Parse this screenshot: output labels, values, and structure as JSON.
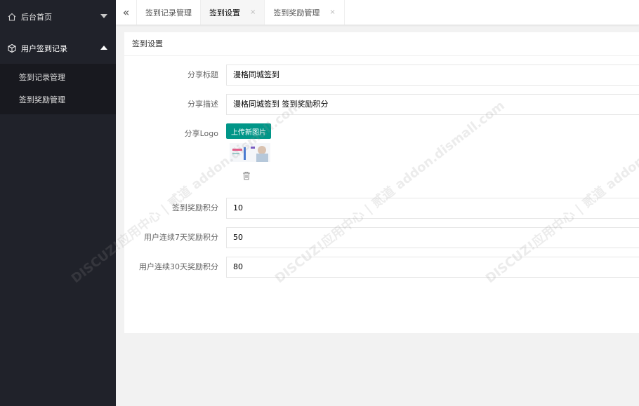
{
  "sidebar": {
    "home_label": "后台首页",
    "group_label": "用户签到记录",
    "items": [
      {
        "label": "签到记录管理"
      },
      {
        "label": "签到奖励管理"
      }
    ]
  },
  "tabs": [
    {
      "label": "签到记录管理"
    },
    {
      "label": "签到设置",
      "close": "×"
    },
    {
      "label": "签到奖励管理",
      "close": "×"
    }
  ],
  "panel": {
    "title": "签到设置",
    "fields": {
      "share_title": {
        "label": "分享标题",
        "value": "漫格同城签到"
      },
      "share_desc": {
        "label": "分享描述",
        "value": "漫格同城签到 签到奖励积分"
      },
      "share_logo": {
        "label": "分享Logo",
        "upload_label": "上传新图片"
      },
      "reward_points": {
        "label": "签到奖励积分",
        "value": "10"
      },
      "streak7_points": {
        "label": "用户连续7天奖励积分",
        "value": "50"
      },
      "streak30_points": {
        "label": "用户连续30天奖励积分",
        "value": "80"
      }
    }
  },
  "watermark": "DISCUZ!应用中心 | 贰道 addon.dismall.com",
  "colors": {
    "sidebar_bg": "#20222a",
    "upload_btn": "#009688"
  }
}
